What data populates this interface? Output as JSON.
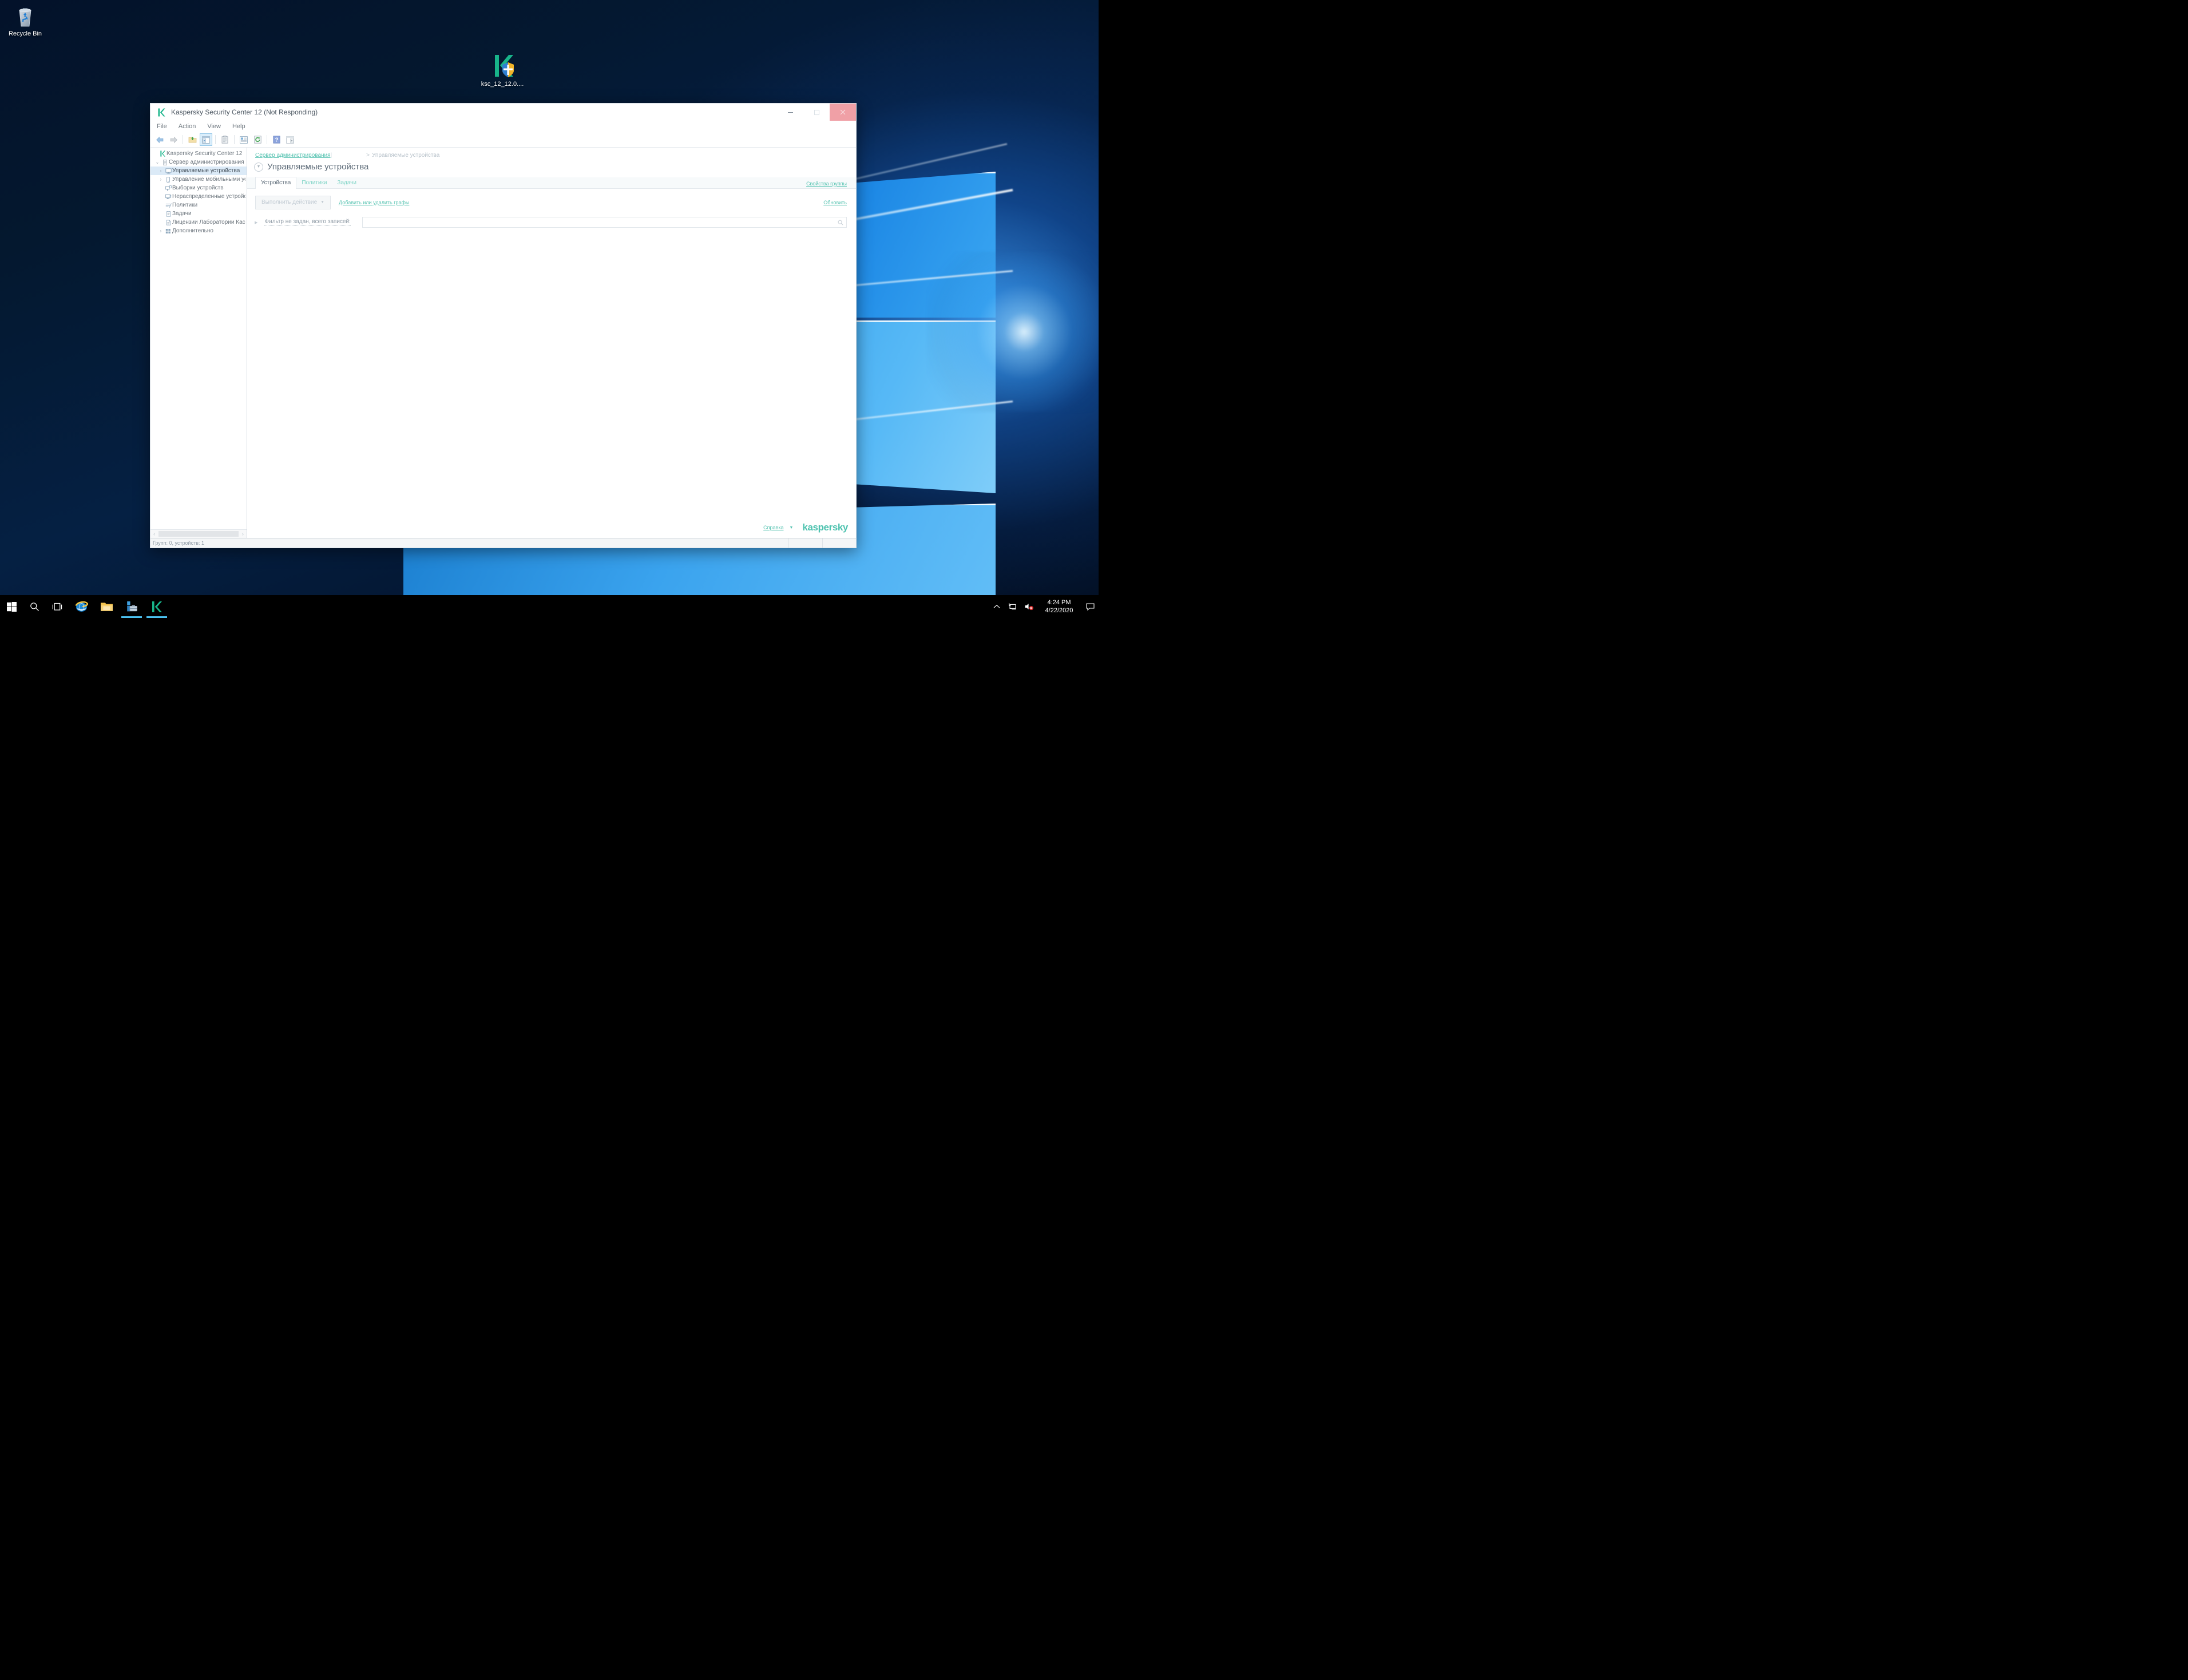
{
  "desktop": {
    "icons": [
      {
        "name": "recycle-bin",
        "label": "Recycle Bin"
      },
      {
        "name": "ksc-installer",
        "label": "ksc_12_12.0...."
      }
    ]
  },
  "taskbar": {
    "buttons": [
      {
        "name": "start",
        "icon": "windows-logo-icon",
        "active": false
      },
      {
        "name": "search",
        "icon": "search-icon",
        "active": false
      },
      {
        "name": "task-view",
        "icon": "task-view-icon",
        "active": false
      },
      {
        "name": "internet-explorer",
        "icon": "internet-explorer-icon",
        "active": false
      },
      {
        "name": "file-explorer",
        "icon": "folder-icon",
        "active": false
      },
      {
        "name": "server-manager",
        "icon": "server-manager-icon",
        "active": true
      },
      {
        "name": "kaspersky-security-center",
        "icon": "kaspersky-k-icon",
        "active": true
      }
    ],
    "tray": {
      "chevron": "show-hidden-icons-icon",
      "network": "network-icon",
      "volume": "volume-muted-icon",
      "action_center": "action-center-icon"
    },
    "clock": {
      "time": "4:24 PM",
      "date": "4/22/2020"
    }
  },
  "window": {
    "title": "Kaspersky Security Center 12 (Not Responding)",
    "icon": "kaspersky-k-icon",
    "controls": {
      "minimize": "minimize-icon",
      "maximize": "maximize-icon",
      "close": "close-icon"
    },
    "menu": [
      "File",
      "Action",
      "View",
      "Help"
    ],
    "toolbar": [
      {
        "name": "back-button",
        "icon": "arrow-left-icon",
        "selected": false
      },
      {
        "name": "forward-button",
        "icon": "arrow-right-icon",
        "selected": false
      },
      {
        "name": "up-one-level-button",
        "icon": "folder-up-icon",
        "selected": false
      },
      {
        "name": "show-hide-tree-button",
        "icon": "show-tree-icon",
        "selected": true
      },
      {
        "name": "properties-button",
        "icon": "clipboard-icon",
        "selected": false
      },
      {
        "name": "list-view-button",
        "icon": "list-view-icon",
        "selected": false
      },
      {
        "name": "refresh-button",
        "icon": "refresh-icon",
        "selected": false
      },
      {
        "name": "help-button",
        "icon": "help-question-icon",
        "selected": false
      },
      {
        "name": "export-list-button",
        "icon": "export-list-icon",
        "selected": false
      }
    ],
    "tree": [
      {
        "label": "Kaspersky Security Center 12",
        "icon": "kaspersky-k-icon",
        "indent": 0,
        "twisty": "",
        "selected": false
      },
      {
        "label": "Сервер администрирования",
        "icon": "server-icon",
        "indent": 1,
        "twisty": "expanded",
        "selected": false
      },
      {
        "label": "Управляемые устройства",
        "icon": "monitor-icon",
        "indent": 2,
        "twisty": "collapsed",
        "selected": true
      },
      {
        "label": "Управление мобильными устрой",
        "icon": "mobile-device-icon",
        "indent": 2,
        "twisty": "collapsed",
        "selected": false
      },
      {
        "label": "Выборки устройств",
        "icon": "device-selection-icon",
        "indent": 2,
        "twisty": "",
        "selected": false
      },
      {
        "label": "Нераспределенные устройства",
        "icon": "unassigned-device-icon",
        "indent": 2,
        "twisty": "",
        "selected": false
      },
      {
        "label": "Политики",
        "icon": "policy-icon",
        "indent": 2,
        "twisty": "",
        "selected": false
      },
      {
        "label": "Задачи",
        "icon": "task-icon",
        "indent": 2,
        "twisty": "",
        "selected": false
      },
      {
        "label": "Лицензии Лаборатории Касперск",
        "icon": "license-icon",
        "indent": 2,
        "twisty": "",
        "selected": false
      },
      {
        "label": "Дополнительно",
        "icon": "advanced-icon",
        "indent": 2,
        "twisty": "collapsed",
        "selected": false
      }
    ],
    "breadcrumb": {
      "link": "Сервер администрирования",
      "redacted": true,
      "separator": ">",
      "current": "Управляемые устройства"
    },
    "page_title": "Управляемые устройства",
    "tabs": [
      {
        "label": "Устройства",
        "active": true
      },
      {
        "label": "Политики",
        "active": false
      },
      {
        "label": "Задачи",
        "active": false
      }
    ],
    "group_properties_link": "Свойства группы",
    "action_button": "Выполнить действие",
    "add_remove_columns_link": "Добавить или удалить графы",
    "refresh_link": "Обновить",
    "filter_label": "Фильтр не задан, всего записей:",
    "search_value": "",
    "search_icon": "search-icon",
    "help_link": "Справка",
    "brand": "kaspersky",
    "statusbar": "Групп: 0, устройств: 1"
  }
}
